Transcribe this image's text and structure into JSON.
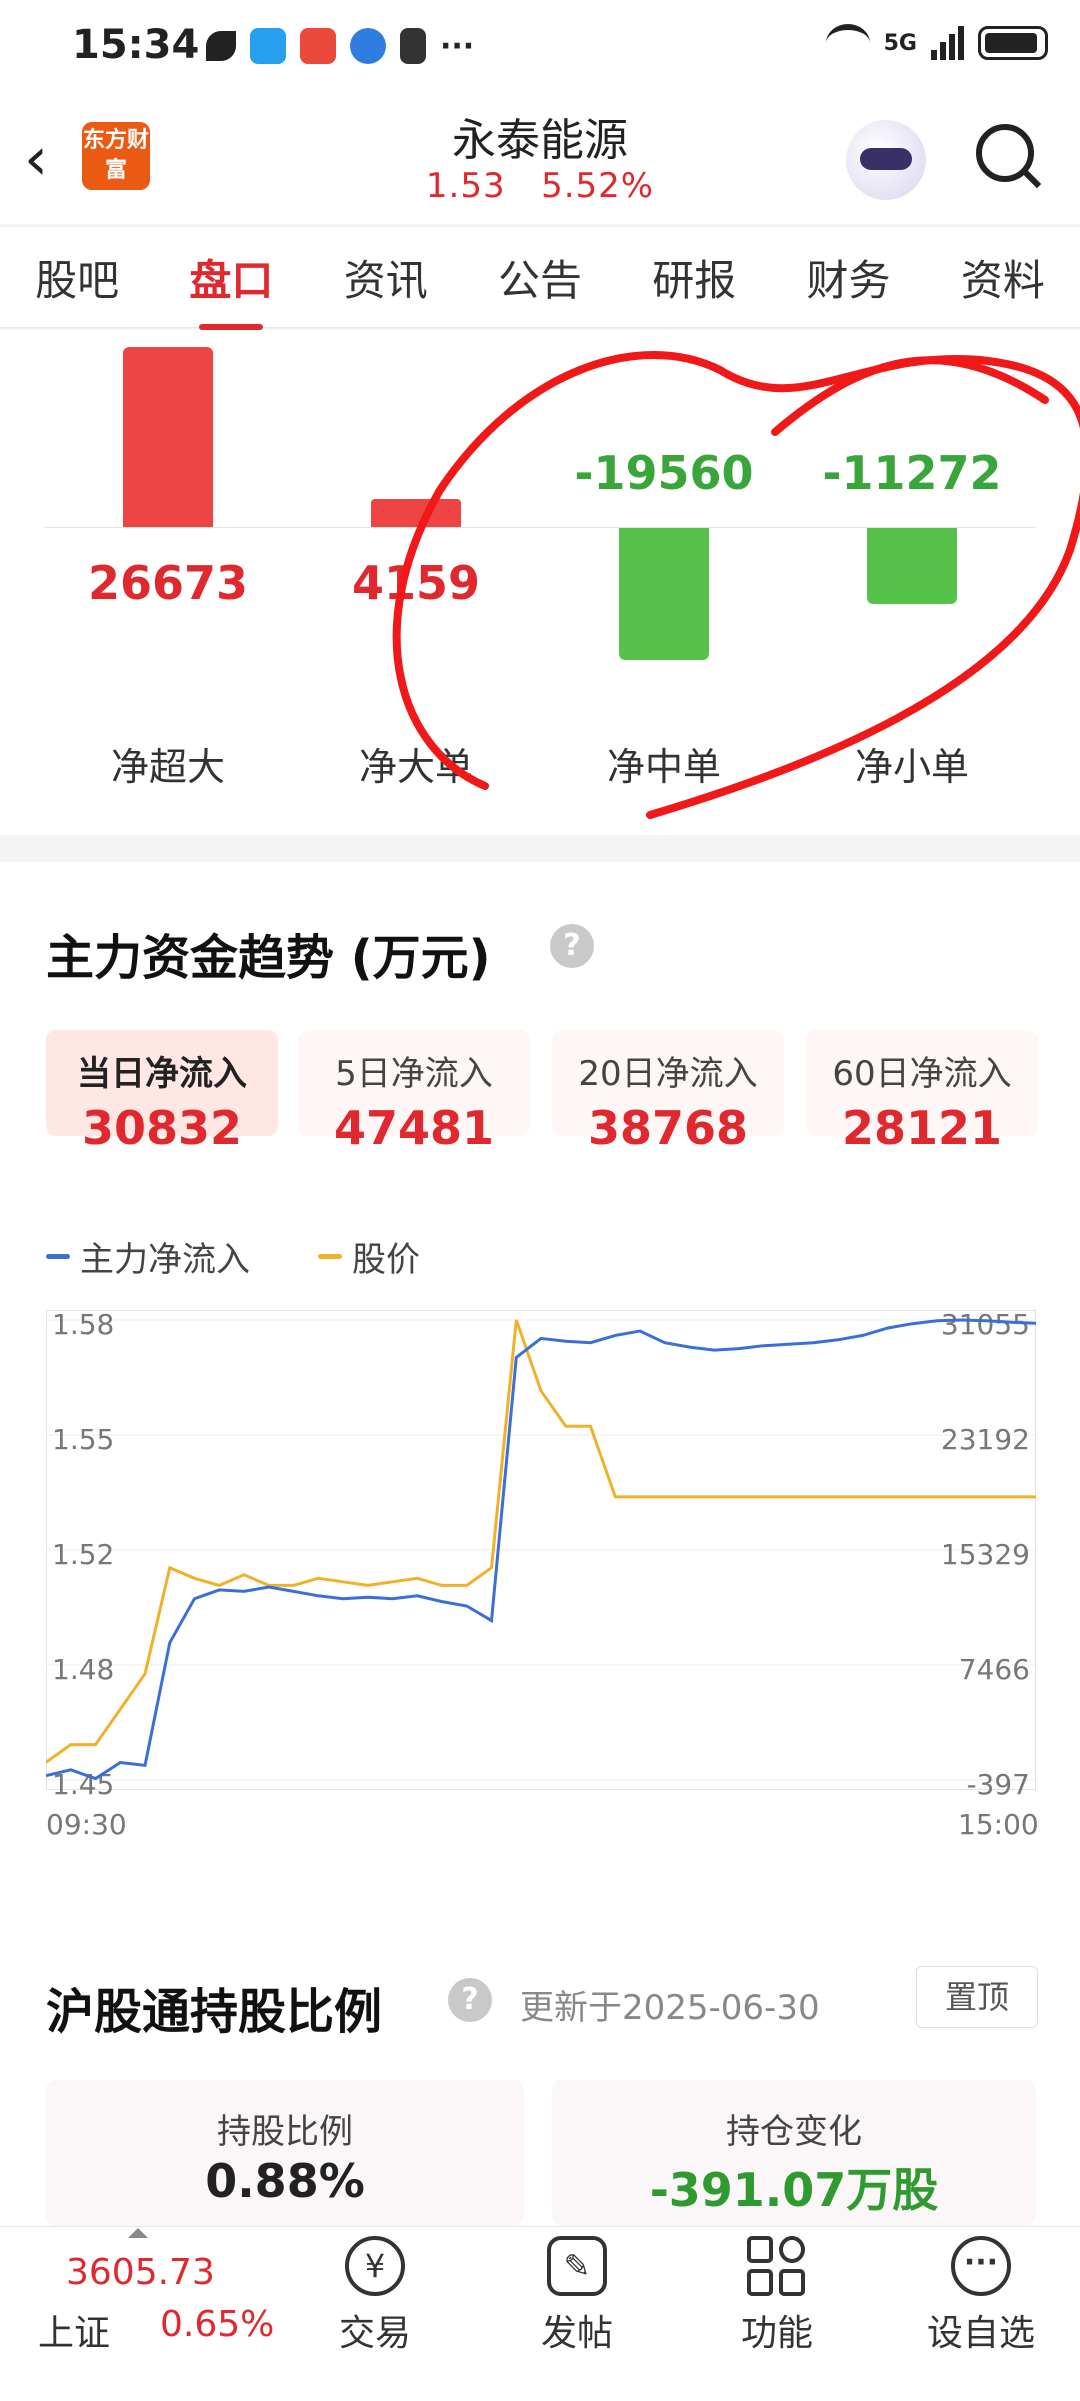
{
  "status_bar": {
    "time": "15:34",
    "more": "···",
    "network": "5G"
  },
  "header": {
    "stock_name": "永泰能源",
    "price": "1.53",
    "change_pct": "5.52%",
    "logo_text": "东方财富",
    "back_icon": "chevron-left-icon"
  },
  "tabs": [
    "股吧",
    "盘口",
    "资讯",
    "公告",
    "研报",
    "财务",
    "资料"
  ],
  "active_tab": "盘口",
  "net_flow": {
    "items": [
      {
        "label": "净超大",
        "value": "26673",
        "color": "#e0292e"
      },
      {
        "label": "净大单",
        "value": "4159",
        "color": "#e0292e"
      },
      {
        "label": "净中单",
        "value": "-19560",
        "color": "#3aa53a"
      },
      {
        "label": "净小单",
        "value": "-11272",
        "color": "#3aa53a"
      }
    ]
  },
  "trend": {
    "title": "主力资金趋势 (万元)",
    "help_icon": "question-circle-icon",
    "periods": [
      {
        "label": "当日净流入",
        "value": "30832",
        "active": true
      },
      {
        "label": "5日净流入",
        "value": "47481"
      },
      {
        "label": "20日净流入",
        "value": "38768"
      },
      {
        "label": "60日净流入",
        "value": "28121"
      }
    ],
    "legend": [
      {
        "name": "主力净流入",
        "color": "#3b6fd8"
      },
      {
        "name": "股价",
        "color": "#f0b12a"
      }
    ],
    "left_ticks": [
      "1.58",
      "1.55",
      "1.52",
      "1.48",
      "1.45"
    ],
    "right_ticks": [
      "31055",
      "23192",
      "15329",
      "7466",
      "-397"
    ],
    "x_start": "09:30",
    "x_end": "15:00"
  },
  "chart_data": {
    "type": "line",
    "x": [
      "09:30",
      "15:00"
    ],
    "series": [
      {
        "name": "主力净流入",
        "axis": "right",
        "values": [
          -100,
          300,
          -300,
          800,
          600,
          9000,
          12000,
          12600,
          12500,
          12800,
          12500,
          12200,
          12000,
          12100,
          12000,
          12200,
          11800,
          11500,
          10500,
          28500,
          29800,
          29600,
          29500,
          30000,
          30300,
          29500,
          29200,
          29000,
          29100,
          29300,
          29400,
          29500,
          29700,
          30000,
          30500,
          30800,
          31000,
          31055,
          31000,
          30900,
          30832
        ]
      },
      {
        "name": "股价",
        "axis": "left",
        "values": [
          1.455,
          1.46,
          1.46,
          1.47,
          1.48,
          1.51,
          1.507,
          1.505,
          1.508,
          1.505,
          1.505,
          1.507,
          1.506,
          1.505,
          1.506,
          1.507,
          1.505,
          1.505,
          1.51,
          1.58,
          1.56,
          1.55,
          1.55,
          1.53,
          1.53,
          1.53,
          1.53,
          1.53,
          1.53,
          1.53,
          1.53,
          1.53,
          1.53,
          1.53,
          1.53,
          1.53,
          1.53,
          1.53,
          1.53,
          1.53,
          1.53
        ]
      }
    ],
    "ylim_left": [
      1.45,
      1.58
    ],
    "ylim_right": [
      -397,
      31055
    ],
    "legend_position": "top-left"
  },
  "hk_connect": {
    "title": "沪股通持股比例",
    "updated": "更新于2025-06-30",
    "pin_label": "置顶",
    "holding_label": "持股比例",
    "holding_value": "0.88%",
    "change_label": "持仓变化",
    "change_value": "-391.07万股"
  },
  "bottom_nav": {
    "index_value": "3605.73",
    "index_name": "上证",
    "index_change": "0.65%",
    "items": [
      {
        "label": "交易",
        "icon": "yen-exchange-icon"
      },
      {
        "label": "发帖",
        "icon": "edit-icon"
      },
      {
        "label": "功能",
        "icon": "apps-icon"
      },
      {
        "label": "设自选",
        "icon": "more-circle-icon"
      }
    ]
  }
}
